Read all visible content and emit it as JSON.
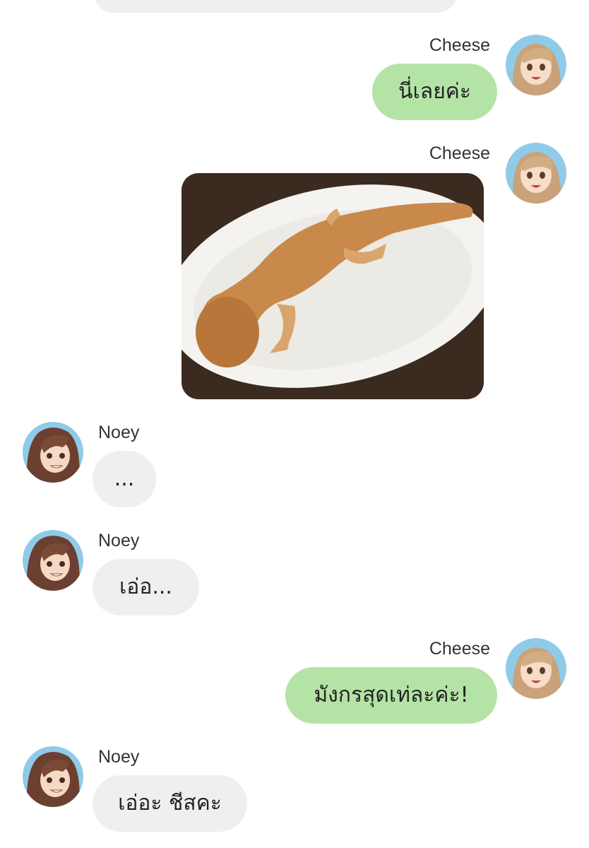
{
  "messages": [
    {
      "sender": "Cheese",
      "text": "นี่เลยค่ะ"
    },
    {
      "sender": "Cheese",
      "image": "salamander-shaped-bread-on-white-plate"
    },
    {
      "sender": "Noey",
      "text": "..."
    },
    {
      "sender": "Noey",
      "text": "เอ่อ..."
    },
    {
      "sender": "Cheese",
      "text": "มังกรสุดเท่ละค่ะ!"
    },
    {
      "sender": "Noey",
      "text": "เอ่อะ ชีสคะ"
    }
  ],
  "colors": {
    "outgoing_bubble": "#b4e3a6",
    "incoming_bubble": "#efefef",
    "background": "#ffffff"
  },
  "avatars": {
    "cheese": "cheese-avatar-icon",
    "noey": "noey-avatar-icon"
  }
}
